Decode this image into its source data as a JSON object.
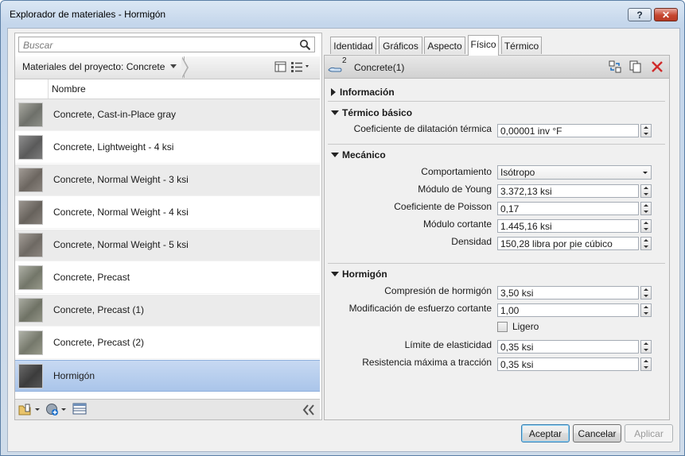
{
  "window": {
    "title": "Explorador de materiales - Hormigón",
    "help_label": "?",
    "close_label": "✕"
  },
  "search": {
    "placeholder": "Buscar"
  },
  "library": {
    "breadcrumb": "Materiales del proyecto: Concrete",
    "column_header": "Nombre"
  },
  "materials": [
    {
      "name": "Concrete, Cast-in-Place gray"
    },
    {
      "name": "Concrete, Lightweight - 4 ksi"
    },
    {
      "name": "Concrete, Normal Weight - 3 ksi"
    },
    {
      "name": "Concrete, Normal Weight - 4 ksi"
    },
    {
      "name": "Concrete, Normal Weight - 5 ksi"
    },
    {
      "name": "Concrete, Precast"
    },
    {
      "name": "Concrete, Precast (1)"
    },
    {
      "name": "Concrete, Precast (2)"
    },
    {
      "name": "Hormigón"
    }
  ],
  "selected_material": "Hormigón",
  "tabs": [
    "Identidad",
    "Gráficos",
    "Aspecto",
    "Físico",
    "Térmico"
  ],
  "active_tab": "Físico",
  "asset": {
    "name": "Concrete(1)",
    "count": "2"
  },
  "sections": {
    "informacion": "Información",
    "termico_basico": "Térmico básico",
    "mecanico": "Mecánico",
    "hormigon": "Hormigón"
  },
  "props": {
    "dilatacion": {
      "label": "Coeficiente de dilatación térmica",
      "value": "0,00001 inv °F"
    },
    "comportamiento": {
      "label": "Comportamiento",
      "value": "Isótropo"
    },
    "young": {
      "label": "Módulo de Young",
      "value": "3.372,13 ksi"
    },
    "poisson": {
      "label": "Coeficiente de Poisson",
      "value": "0,17"
    },
    "cortante": {
      "label": "Módulo cortante",
      "value": "1.445,16 ksi"
    },
    "densidad": {
      "label": "Densidad",
      "value": "150,28 libra por pie cúbico"
    },
    "compresion": {
      "label": "Compresión de hormigón",
      "value": "3,50 ksi"
    },
    "modificacion": {
      "label": "Modificación de esfuerzo cortante",
      "value": "1,00"
    },
    "ligero": {
      "label": "Ligero",
      "checked": false
    },
    "elasticidad": {
      "label": "Límite de elasticidad",
      "value": "0,35 ksi"
    },
    "traccion": {
      "label": "Resistencia máxima a tracción",
      "value": "0,35 ksi"
    }
  },
  "buttons": {
    "ok": "Aceptar",
    "cancel": "Cancelar",
    "apply": "Aplicar"
  }
}
